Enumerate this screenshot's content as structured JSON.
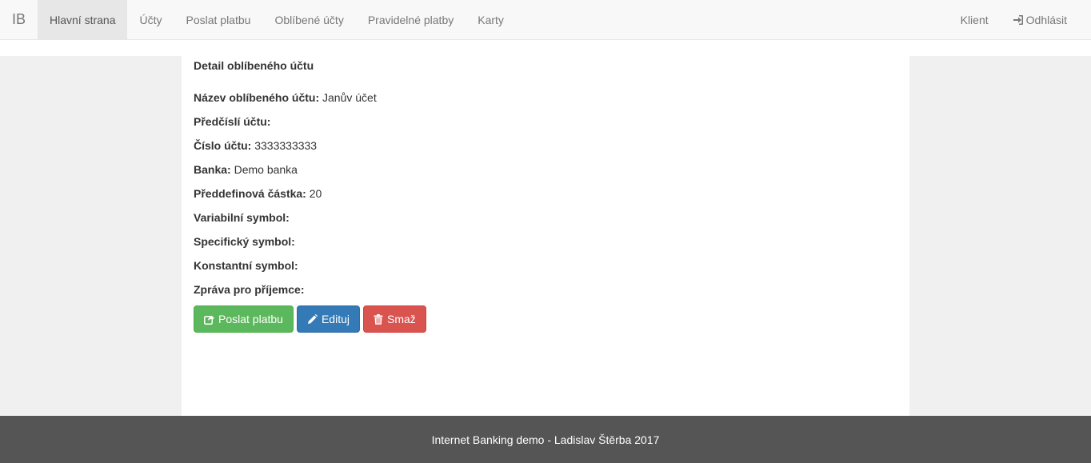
{
  "nav": {
    "brand": "IB",
    "items": [
      {
        "label": "Hlavní strana"
      },
      {
        "label": "Účty"
      },
      {
        "label": "Poslat platbu"
      },
      {
        "label": "Oblíbené účty"
      },
      {
        "label": "Pravidelné platby"
      },
      {
        "label": "Karty"
      }
    ],
    "active_index": 0,
    "client": "Klient",
    "logout": "Odhlásit",
    "logout_icon": "log-in-icon"
  },
  "detail": {
    "title": "Detail oblíbeného účtu",
    "fields": [
      {
        "label": "Název oblíbeného účtu:",
        "value": "Janův účet"
      },
      {
        "label": "Předčíslí účtu:",
        "value": ""
      },
      {
        "label": "Číslo účtu:",
        "value": "3333333333"
      },
      {
        "label": "Banka:",
        "value": "Demo banka"
      },
      {
        "label": "Předdefinová částka:",
        "value": "20"
      },
      {
        "label": "Variabilní symbol:",
        "value": ""
      },
      {
        "label": "Specifický symbol:",
        "value": ""
      },
      {
        "label": "Konstantní symbol:",
        "value": ""
      },
      {
        "label": "Zpráva pro příjemce:",
        "value": ""
      }
    ]
  },
  "actions": {
    "send": {
      "label": "Poslat platbu",
      "icon": "share-icon",
      "color": "#5cb85c"
    },
    "edit": {
      "label": "Edituj",
      "icon": "pencil-icon",
      "color": "#337ab7"
    },
    "delete": {
      "label": "Smaž",
      "icon": "trash-icon",
      "color": "#d9534f"
    }
  },
  "footer": {
    "text": "Internet Banking demo - Ladislav Štěrba 2017"
  }
}
